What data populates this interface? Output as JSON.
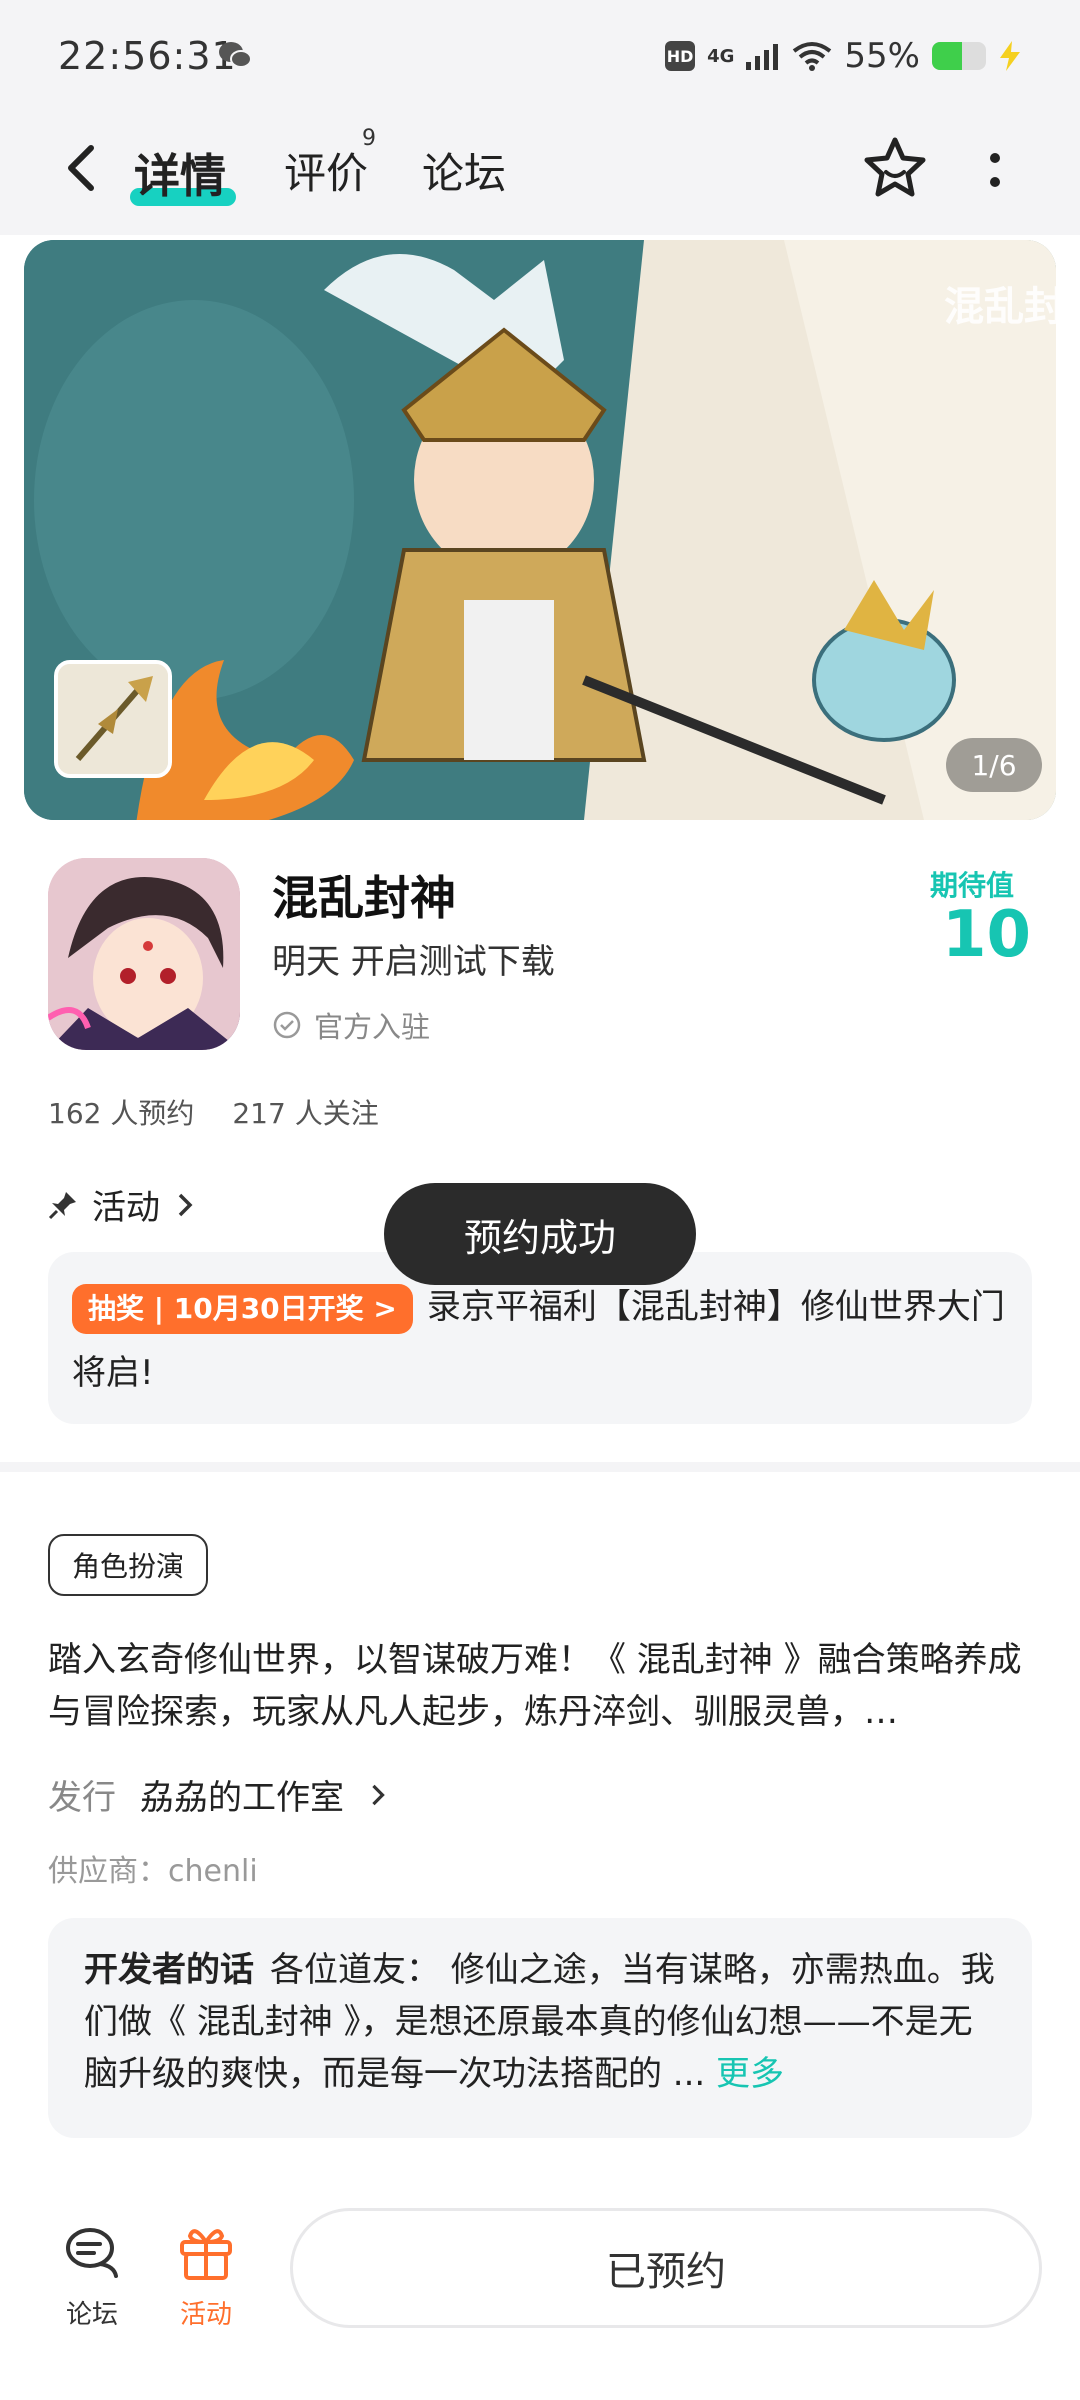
{
  "status_bar": {
    "time": "22:56:31",
    "network": "4G",
    "battery": "55%",
    "battery_level": 0.55,
    "hd": "HD"
  },
  "nav": {
    "tabs": [
      {
        "label": "详情",
        "active": true
      },
      {
        "label": "评价",
        "badge": "9"
      },
      {
        "label": "论坛"
      }
    ]
  },
  "banner": {
    "counter": "1/6"
  },
  "game": {
    "title": "混乱封神",
    "subtitle": "明天 开启测试下载",
    "official": "官方入驻",
    "expect_label": "期待值",
    "expect_value": "10",
    "stats": [
      "162 人预约",
      "217 人关注"
    ]
  },
  "activity": {
    "header": "活动",
    "tag": "抽奖 | 10月30日开奖 >",
    "text": "录京平福利【混乱封神】修仙世界大门将启!"
  },
  "toast": "预约成功",
  "details": {
    "genre_tag": "角色扮演",
    "description": "踏入玄奇修仙世界，以智谋破万难！《 混乱封神 》融合策略养成与冒险探索，玩家从凡人起步，炼丹淬剑、驯服灵兽，…",
    "publisher_label": "发行",
    "publisher_value": "劦劦的工作室",
    "supplier": "供应商：chenli"
  },
  "developer": {
    "label": "开发者的话",
    "text": "各位道友： 修仙之途，当有谋略，亦需热血。我们做《 混乱封神 》，是想还原最本真的修仙幻想——不是无脑升级的爽快，而是每一次功法搭配的 ... ",
    "more": "更多"
  },
  "bottom_bar": {
    "forum": "论坛",
    "activity": "活动",
    "reserve_button": "已预约"
  },
  "colors": {
    "accent": "#17c5b2",
    "orange": "#ff6f2c"
  }
}
